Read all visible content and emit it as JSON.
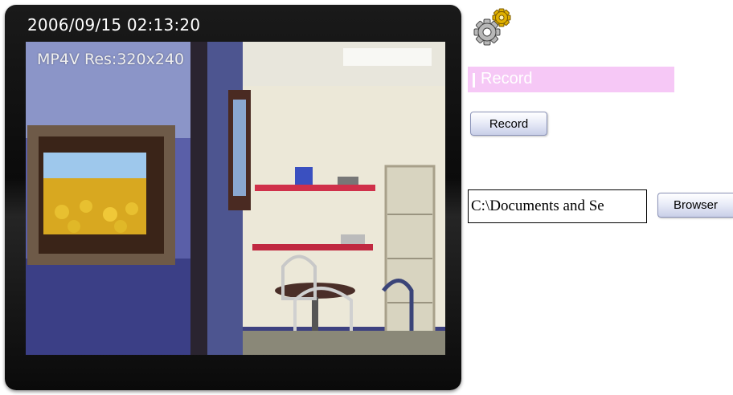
{
  "viewer": {
    "timestamp": "2006/09/15 02:13:20",
    "codec_info": "MP4V Res:320x240"
  },
  "panel": {
    "gear_icon": "gear-icon",
    "section_title": "Record",
    "record_button": "Record",
    "path_value": "C:\\Documents and Se",
    "browse_button": "Browser"
  },
  "colors": {
    "section_bar": "#f6c8f6",
    "frame": "#111111"
  }
}
